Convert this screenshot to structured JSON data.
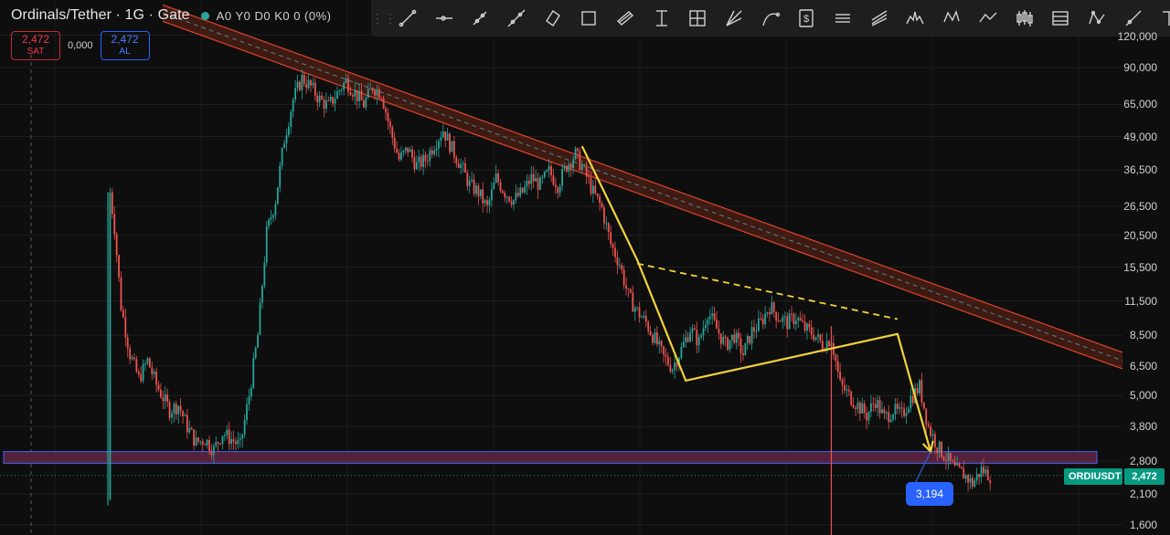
{
  "header": {
    "title": "Ordinals/Tether · 1G · Gate",
    "ohlc": "A0 Y0 D0 K0 0 (0%)"
  },
  "trade": {
    "sell_price": "2,472",
    "sell_label": "SAT",
    "spread": "0,000",
    "buy_price": "2,472",
    "buy_label": "AL"
  },
  "toolbar": {
    "tools": [
      "trend-line-icon",
      "horizontal-ray-icon",
      "info-line-icon",
      "extended-line-icon",
      "rotated-rectangle-icon",
      "rectangle-icon",
      "parallel-channel-icon",
      "date-range-icon",
      "cross-measure-icon",
      "fib-fan-icon",
      "arc-icon",
      "price-range-icon",
      "long-position-icon",
      "flat-top-bottom-icon",
      "head-shoulders-icon",
      "xabcd-pattern-icon",
      "path-icon",
      "candles-icon",
      "table-icon",
      "polyline-icon",
      "ray-icon",
      "text-icon"
    ]
  },
  "colors": {
    "background": "#0e0e0e",
    "up": "#26a69a",
    "down": "#ef5350",
    "channel": "#e0452a",
    "pattern": "#f2d33a",
    "support_zone": "#5b2340",
    "support_border": "#3f5bd8",
    "projection": "#2a62e0",
    "last_price": "#089981"
  },
  "price_axis": {
    "ticks": [
      "120,000",
      "90,000",
      "65,000",
      "49,000",
      "36,500",
      "26,500",
      "20,500",
      "15,500",
      "11,500",
      "8,500",
      "6,500",
      "5,000",
      "3,800",
      "2,800",
      "2,100",
      "1,600"
    ]
  },
  "last_price": {
    "symbol": "ORDIUSDT",
    "value": "2,472"
  },
  "projection_label": "3,194",
  "chart_data": {
    "type": "candlestick",
    "symbol": "ORDIUSDT",
    "y_scale": "log",
    "ylim": [
      1500,
      125000
    ],
    "y_ticks": [
      120000,
      90000,
      65000,
      49000,
      36500,
      26500,
      20500,
      15500,
      11500,
      8500,
      6500,
      5000,
      3800,
      2800,
      2100,
      1600
    ],
    "x_index_range": [
      0,
      460
    ],
    "series_close": [
      [
        0,
        2000
      ],
      [
        1,
        30000
      ],
      [
        3,
        22000
      ],
      [
        6,
        11000
      ],
      [
        10,
        7200
      ],
      [
        14,
        5800
      ],
      [
        18,
        6800
      ],
      [
        22,
        5500
      ],
      [
        28,
        4400
      ],
      [
        32,
        4600
      ],
      [
        36,
        3800
      ],
      [
        40,
        3300
      ],
      [
        44,
        3400
      ],
      [
        48,
        3100
      ],
      [
        52,
        3600
      ],
      [
        56,
        3400
      ],
      [
        60,
        3200
      ],
      [
        64,
        5000
      ],
      [
        68,
        8500
      ],
      [
        72,
        21000
      ],
      [
        76,
        28000
      ],
      [
        80,
        48000
      ],
      [
        84,
        68000
      ],
      [
        88,
        82000
      ],
      [
        92,
        76000
      ],
      [
        96,
        68000
      ],
      [
        100,
        64000
      ],
      [
        104,
        72000
      ],
      [
        108,
        80000
      ],
      [
        112,
        72000
      ],
      [
        116,
        65000
      ],
      [
        120,
        76000
      ],
      [
        124,
        72000
      ],
      [
        128,
        52000
      ],
      [
        132,
        40000
      ],
      [
        136,
        44000
      ],
      [
        140,
        38000
      ],
      [
        144,
        40000
      ],
      [
        148,
        46000
      ],
      [
        152,
        52000
      ],
      [
        156,
        44000
      ],
      [
        160,
        38000
      ],
      [
        164,
        32000
      ],
      [
        168,
        30000
      ],
      [
        172,
        26000
      ],
      [
        176,
        34000
      ],
      [
        180,
        30000
      ],
      [
        184,
        28000
      ],
      [
        188,
        30000
      ],
      [
        192,
        34000
      ],
      [
        196,
        32000
      ],
      [
        200,
        36000
      ],
      [
        204,
        32000
      ],
      [
        208,
        38000
      ],
      [
        212,
        42000
      ],
      [
        216,
        36000
      ],
      [
        220,
        30000
      ],
      [
        224,
        26000
      ],
      [
        228,
        19000
      ],
      [
        232,
        16000
      ],
      [
        236,
        12000
      ],
      [
        240,
        10500
      ],
      [
        244,
        9500
      ],
      [
        248,
        8200
      ],
      [
        252,
        7000
      ],
      [
        256,
        6400
      ],
      [
        260,
        7500
      ],
      [
        264,
        9000
      ],
      [
        268,
        8000
      ],
      [
        272,
        10500
      ],
      [
        276,
        9000
      ],
      [
        280,
        7800
      ],
      [
        284,
        8500
      ],
      [
        288,
        7200
      ],
      [
        292,
        8800
      ],
      [
        296,
        9500
      ],
      [
        300,
        11000
      ],
      [
        304,
        10000
      ],
      [
        308,
        9500
      ],
      [
        312,
        10000
      ],
      [
        316,
        9000
      ],
      [
        320,
        8600
      ],
      [
        324,
        7800
      ],
      [
        328,
        8300
      ],
      [
        332,
        5500
      ],
      [
        336,
        5000
      ],
      [
        340,
        4600
      ],
      [
        344,
        4200
      ],
      [
        348,
        4800
      ],
      [
        352,
        4100
      ],
      [
        356,
        4400
      ],
      [
        360,
        4200
      ],
      [
        364,
        4900
      ],
      [
        368,
        5400
      ],
      [
        372,
        3800
      ],
      [
        376,
        3200
      ],
      [
        380,
        2900
      ],
      [
        384,
        2600
      ],
      [
        388,
        2500
      ],
      [
        392,
        2300
      ],
      [
        396,
        2600
      ],
      [
        400,
        2472
      ]
    ],
    "drawings": [
      {
        "type": "descending_channel",
        "from": {
          "x": 0,
          "y": 130000
        },
        "to": {
          "x": 460,
          "y": 6800
        }
      },
      {
        "type": "support_zone",
        "y_range": [
          2750,
          3050
        ]
      },
      {
        "type": "pattern_line",
        "points": [
          [
            215,
            45000
          ],
          [
            240,
            16500
          ],
          [
            262,
            5700
          ],
          [
            358,
            8600
          ],
          [
            373,
            3050
          ]
        ]
      },
      {
        "type": "dashed_resistance",
        "from": [
          240,
          16000
        ],
        "to": [
          358,
          9800
        ]
      },
      {
        "type": "projection_line",
        "from": [
          373,
          3050
        ],
        "to": [
          434,
          2150
        ],
        "label": "3,194"
      },
      {
        "type": "horizontal_dotted",
        "y": 2472
      }
    ]
  }
}
